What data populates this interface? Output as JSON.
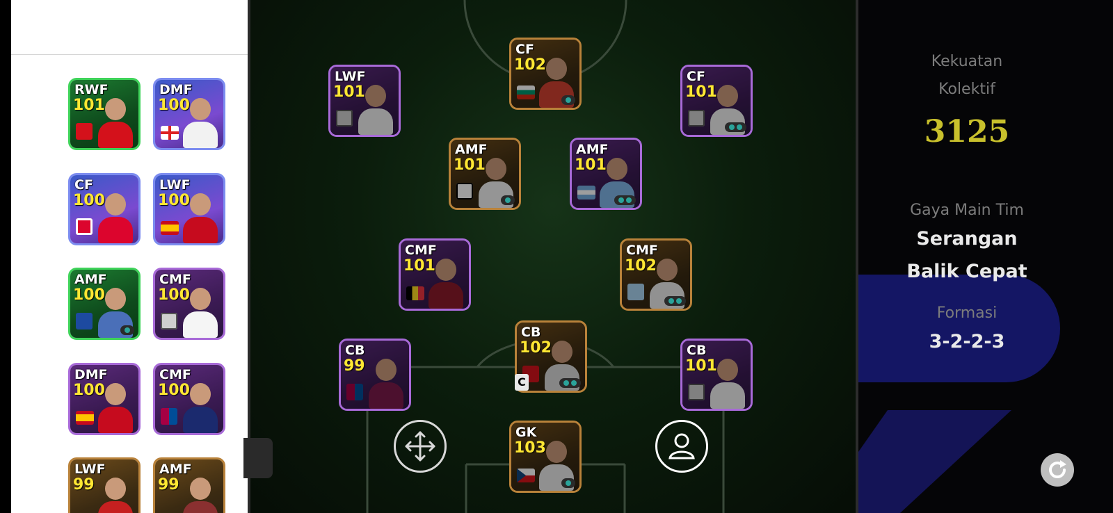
{
  "sidebar": {
    "players": [
      {
        "pos": "RWF",
        "rating": "101",
        "badge": "crest-ars",
        "style": "green",
        "shirt": "#d4111b"
      },
      {
        "pos": "DMF",
        "rating": "100",
        "badge": "flag-eng",
        "style": "blue",
        "shirt": "#f2f2f2"
      },
      {
        "pos": "CF",
        "rating": "100",
        "badge": "crest-bay",
        "style": "blue",
        "shirt": "#dc052d"
      },
      {
        "pos": "LWF",
        "rating": "100",
        "badge": "flag-esp",
        "style": "blue",
        "shirt": "#c60b1e"
      },
      {
        "pos": "AMF",
        "rating": "100",
        "badge": "crest-club",
        "style": "green",
        "shirt": "#4a6fb8",
        "skills": 1
      },
      {
        "pos": "CMF",
        "rating": "100",
        "badge": "crest-grey",
        "style": "purple",
        "shirt": "#f5f5f5"
      },
      {
        "pos": "DMF",
        "rating": "100",
        "badge": "flag-esp",
        "style": "purple",
        "shirt": "#c60b1e"
      },
      {
        "pos": "CMF",
        "rating": "100",
        "badge": "crest-bar",
        "style": "purple",
        "shirt": "#1b2a6e"
      },
      {
        "pos": "LWF",
        "rating": "99",
        "badge": "",
        "style": "gold",
        "shirt": "#c62020"
      },
      {
        "pos": "AMF",
        "rating": "99",
        "badge": "",
        "style": "gold",
        "shirt": "#8a3030"
      }
    ]
  },
  "formation_players": [
    {
      "pos": "CF",
      "rating": "102",
      "badge": "flag-bul",
      "style": "gold",
      "shirt": "#d04030",
      "skills": 1
    },
    {
      "pos": "LWF",
      "rating": "101",
      "badge": "crest-grey",
      "style": "purple",
      "shirt": "#efefef"
    },
    {
      "pos": "CF",
      "rating": "101",
      "badge": "crest-grey",
      "style": "purple",
      "shirt": "#efefef",
      "skills": 2
    },
    {
      "pos": "AMF",
      "rating": "101",
      "badge": "crest-santos",
      "style": "gold",
      "shirt": "#f0f0f0",
      "skills": 1
    },
    {
      "pos": "AMF",
      "rating": "101",
      "badge": "flag-arg",
      "style": "purple",
      "shirt": "#7fb4e6",
      "skills": 2
    },
    {
      "pos": "CMF",
      "rating": "101",
      "badge": "flag-bel",
      "style": "purple",
      "shirt": "#8a1a2a"
    },
    {
      "pos": "CMF",
      "rating": "102",
      "badge": "crest-laz",
      "style": "gold",
      "shirt": "#eaeaea",
      "skills": 2
    },
    {
      "pos": "CB",
      "rating": "99",
      "badge": "crest-bar",
      "style": "purple",
      "shirt": "#7a1a4a"
    },
    {
      "pos": "CB",
      "rating": "102",
      "badge": "crest-ars",
      "style": "gold",
      "shirt": "#d8d8d8",
      "skills": 2
    },
    {
      "pos": "CB",
      "rating": "101",
      "badge": "crest-grey",
      "style": "purple",
      "shirt": "#efefef"
    },
    {
      "pos": "GK",
      "rating": "103",
      "badge": "flag-cze",
      "style": "gold",
      "shirt": "#e8e8e8",
      "skills": 1
    }
  ],
  "captain_label": "C",
  "info": {
    "power_label_1": "Kekuatan",
    "power_label_2": "Kolektif",
    "power_value": "3125",
    "style_label": "Gaya Main Tim",
    "style_value_1": "Serangan",
    "style_value_2": "Balik Cepat",
    "formation_label": "Formasi",
    "formation_value": "3-2-2-3"
  },
  "icons": {
    "move": "move-arrows-icon",
    "player": "user-icon",
    "refresh": "refresh-icon"
  },
  "colors": {
    "rating_yellow": "#ffe733",
    "power_value": "#c8c02c",
    "panel_shape": "#141664"
  }
}
